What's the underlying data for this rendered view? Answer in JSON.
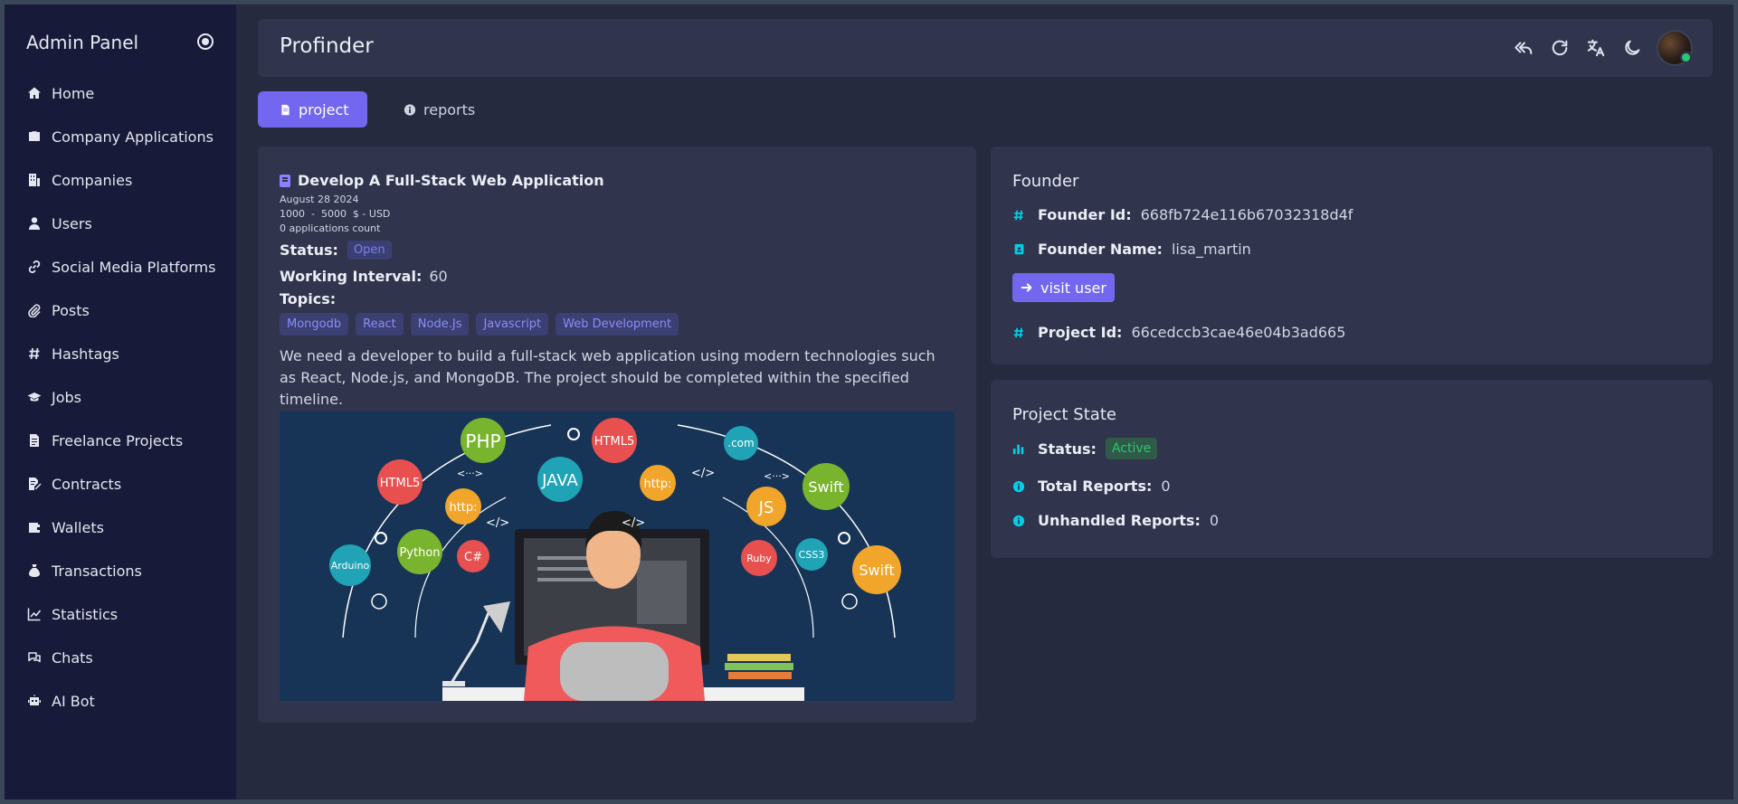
{
  "sidebar": {
    "brand": "Admin Panel",
    "items": [
      {
        "label": "Home",
        "icon": "home-icon"
      },
      {
        "label": "Company Applications",
        "icon": "briefcase-icon"
      },
      {
        "label": "Companies",
        "icon": "building-icon"
      },
      {
        "label": "Users",
        "icon": "user-icon"
      },
      {
        "label": "Social Media Platforms",
        "icon": "link-icon"
      },
      {
        "label": "Posts",
        "icon": "paperclip-icon"
      },
      {
        "label": "Hashtags",
        "icon": "hashtag-icon"
      },
      {
        "label": "Jobs",
        "icon": "graduation-cap-icon"
      },
      {
        "label": "Freelance Projects",
        "icon": "file-icon"
      },
      {
        "label": "Contracts",
        "icon": "file-signature-icon"
      },
      {
        "label": "Wallets",
        "icon": "wallet-icon"
      },
      {
        "label": "Transactions",
        "icon": "money-bag-icon"
      },
      {
        "label": "Statistics",
        "icon": "line-chart-icon"
      },
      {
        "label": "Chats",
        "icon": "chat-icon"
      },
      {
        "label": "AI Bot",
        "icon": "robot-icon"
      }
    ]
  },
  "header": {
    "title": "Profinder"
  },
  "tabs": [
    {
      "label": "project",
      "icon": "file-icon"
    },
    {
      "label": "reports",
      "icon": "info-icon"
    }
  ],
  "project": {
    "title": "Develop A Full-Stack Web Application",
    "date": "August 28 2024",
    "budget": "1000  -  5000  $ - USD",
    "applications": "0 applications count",
    "status_label": "Status:",
    "status": "Open",
    "interval_label": "Working Interval:",
    "interval": "60",
    "topics_label": "Topics:",
    "topics": [
      "Mongodb",
      "React",
      "Node.Js",
      "Javascript",
      "Web Development"
    ],
    "description": "We need a developer to build a full-stack web application using modern technologies such as React, Node.js, and MongoDB. The project should be completed within the specified timeline.",
    "hero_words": [
      "PHP",
      "HTML5",
      "HTML5",
      "JAVA",
      "http:",
      "http:",
      "JS",
      "Swift",
      "Swift",
      "Python",
      "C#",
      "Ruby",
      "CSS3",
      "Arduino",
      ".com",
      "<···>",
      "<···>",
      "</>",
      "</>",
      "</>"
    ]
  },
  "founder": {
    "heading": "Founder",
    "id_label": "Founder Id:",
    "id": "668fb724e116b67032318d4f",
    "name_label": "Founder Name:",
    "name": "lisa_martin",
    "visit_label": "visit user",
    "project_id_label": "Project Id:",
    "project_id": "66cedccb3cae46e04b3ad665"
  },
  "state": {
    "heading": "Project State",
    "status_label": "Status:",
    "status": "Active",
    "total_label": "Total Reports:",
    "total": "0",
    "unhandled_label": "Unhandled Reports:",
    "unhandled": "0"
  },
  "colors": {
    "accent": "#7367f0",
    "success": "#28c76f",
    "info": "#00cfe8"
  }
}
